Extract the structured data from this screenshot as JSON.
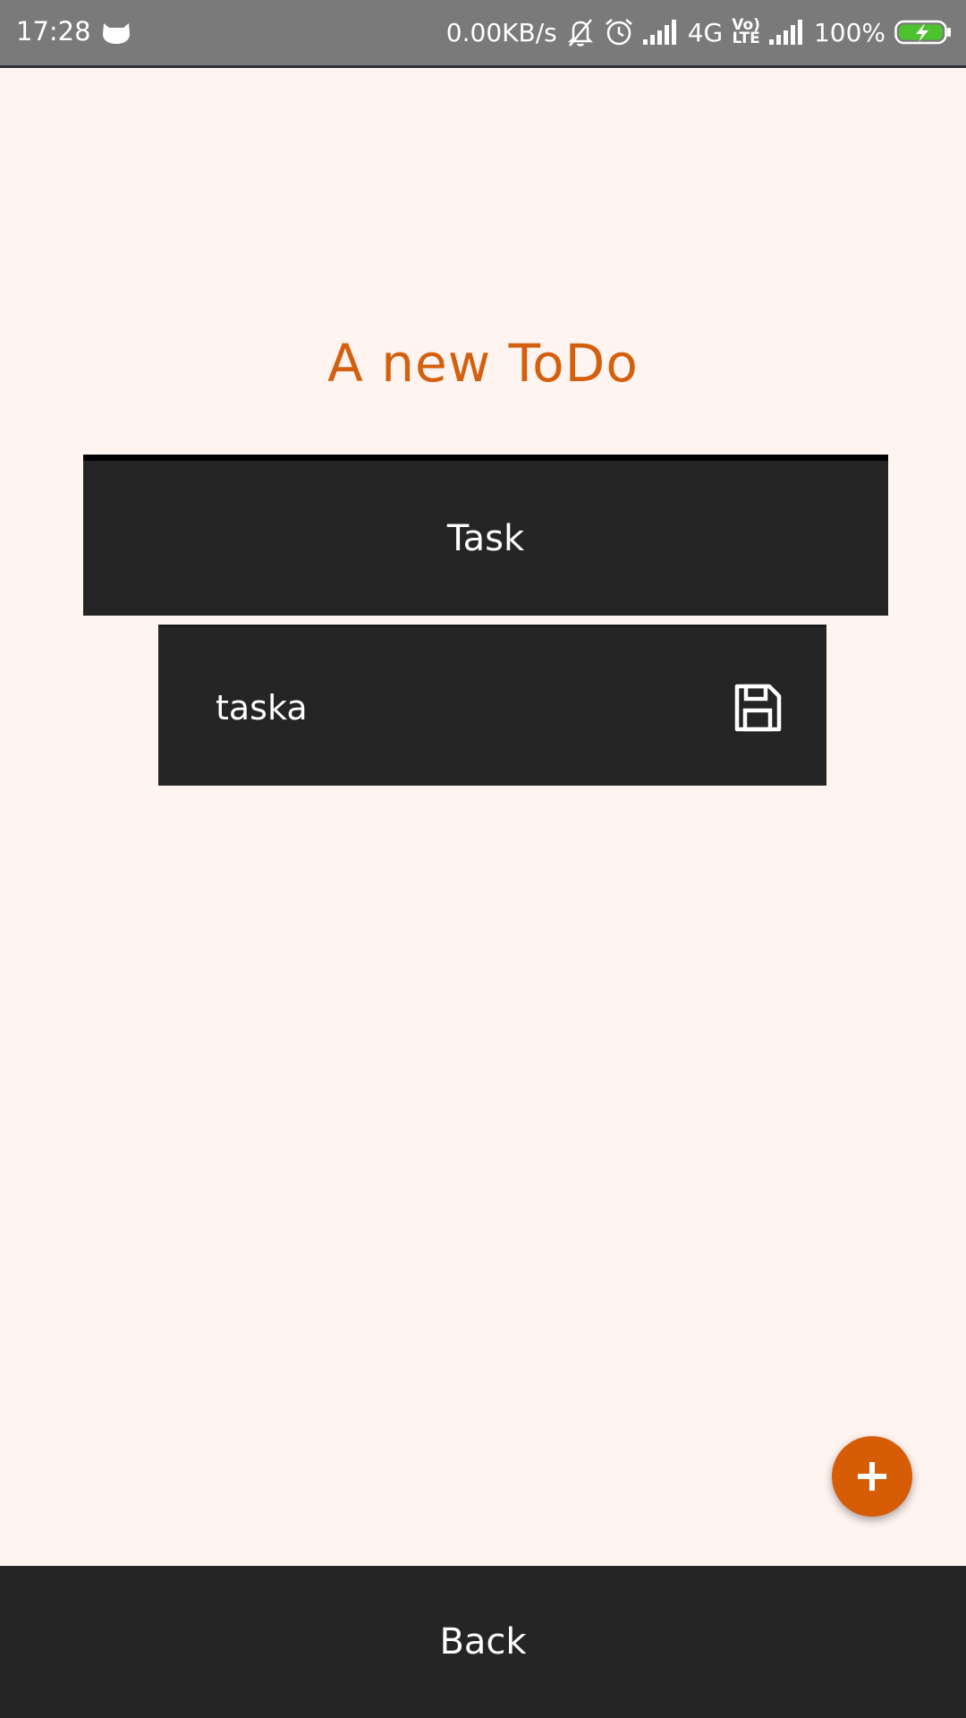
{
  "status_bar": {
    "time": "17:28",
    "net_speed": "0.00KB/s",
    "network_type": "4G",
    "volte_top": "Vo)",
    "volte_bottom": "LTE",
    "battery": "100%",
    "icons": [
      "cat-notification-icon",
      "mute-icon",
      "alarm-icon",
      "signal-icon",
      "signal-icon",
      "battery-charging-icon"
    ]
  },
  "page": {
    "title": "A new ToDo"
  },
  "task_header": {
    "label": "Task"
  },
  "task_input": {
    "value": "taska",
    "icon": "save-icon"
  },
  "fab": {
    "icon": "plus-icon"
  },
  "bottom_bar": {
    "label": "Back"
  },
  "colors": {
    "background": "#fff4f0",
    "accent": "#d65c05",
    "title": "#d4600f",
    "card": "#252525",
    "status_bar": "#7a7a7a"
  }
}
